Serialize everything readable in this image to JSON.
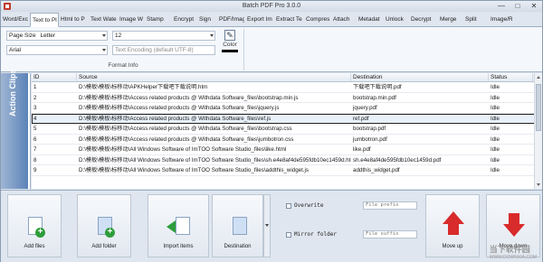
{
  "window": {
    "title": "Batch PDF Pro 3.0.0",
    "minimize": "—",
    "maximize": "□",
    "close": "✕"
  },
  "tabs": [
    "Word/Exc",
    "Text to Pl",
    "Html to P",
    "Text Wate",
    "Image W",
    "Stamp",
    "Encrypt",
    "Sign",
    "PDF/Imag",
    "Export Im",
    "Extract Te",
    "Compres",
    "Attach",
    "Metadat",
    "Unlock",
    "Decrypt",
    "Merge",
    "Split",
    "Image/R"
  ],
  "active_tab_index": 1,
  "ribbon": {
    "page_size_label": "Page Size",
    "page_size_value": "Letter",
    "font_size_value": "12",
    "font_value": "Arial",
    "encoding_placeholder": "Text Encoding (default UTF-8)",
    "color_label": "Color",
    "color_value": "#000000",
    "group_label": "Format Info"
  },
  "sidebar": {
    "label": "Action Clips"
  },
  "table": {
    "headers": {
      "id": "ID",
      "source": "Source",
      "destination": "Destination",
      "status": "Status"
    },
    "rows": [
      {
        "id": "1",
        "source": "D:\\模板\\模板\\标移动\\APKHelper下载吧下载说明.htm",
        "destination": "下载吧下载说明.pdf",
        "status": "Idle"
      },
      {
        "id": "2",
        "source": "D:\\模板\\模板\\标移动\\Access related products @ Withdata Software_files\\bootstrap.min.js",
        "destination": "bootstrap.min.pdf",
        "status": "Idle"
      },
      {
        "id": "3",
        "source": "D:\\模板\\模板\\标移动\\Access related products @ Withdata Software_files\\jquery.js",
        "destination": "jquery.pdf",
        "status": "Idle"
      },
      {
        "id": "4",
        "source": "D:\\模板\\模板\\标移动\\Access related products @ Withdata Software_files\\ref.js",
        "destination": "ref.pdf",
        "status": "Idle"
      },
      {
        "id": "5",
        "source": "D:\\模板\\模板\\标移动\\Access related products @ Withdata Software_files\\bootstrap.css",
        "destination": "bootstrap.pdf",
        "status": "Idle"
      },
      {
        "id": "6",
        "source": "D:\\模板\\模板\\标移动\\Access related products @ Withdata Software_files\\jumbotron.css",
        "destination": "jumbotron.pdf",
        "status": "Idle"
      },
      {
        "id": "7",
        "source": "D:\\模板\\模板\\标移动\\All Windows Software of ImTOO Software Studio_files\\like.html",
        "destination": "like.pdf",
        "status": "Idle"
      },
      {
        "id": "8",
        "source": "D:\\模板\\模板\\标移动\\All Windows Software of ImTOO Software Studio_files\\sh.e4e8af4de595fdb10ec1459d.html",
        "destination": "sh.e4e8af4de595fdb10ec1459d.pdf",
        "status": "Idle"
      },
      {
        "id": "9",
        "source": "D:\\模板\\模板\\标移动\\All Windows Software of ImTOO Software Studio_files\\addthis_widget.js",
        "destination": "addthis_widget.pdf",
        "status": "Idle"
      }
    ],
    "selected_row": 3
  },
  "toolbar": {
    "add_files": "Add files",
    "add_folder": "Add folder",
    "import_items": "Import items",
    "destination": "Destination",
    "overwrite": "Overwrite",
    "mirror_folder": "Mirror folder",
    "file_prefix_placeholder": "File prefix",
    "file_suffix_placeholder": "File suffix",
    "move_up": "Move up",
    "move_down": "Move down"
  },
  "watermark": {
    "text": "当下软件园",
    "sub": "WWW.DOWNXIA.COM"
  }
}
